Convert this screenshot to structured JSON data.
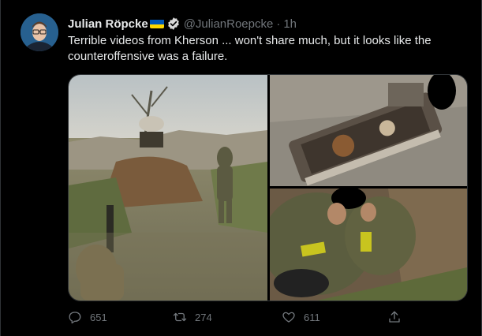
{
  "tweet": {
    "author_name": "Julian Röpcke",
    "handle": "@JulianRoepcke",
    "separator": "·",
    "time": "1h",
    "text": "Terrible videos from Kherson ... won't share much, but it looks like the counteroffensive was a failure.",
    "verified": true
  },
  "actions": {
    "reply_count": "651",
    "retweet_count": "274",
    "like_count": "611"
  },
  "icons": {
    "verified": "verified-badge-icon",
    "flag": "ukraine-flag-icon",
    "reply": "reply-icon",
    "retweet": "retweet-icon",
    "like": "heart-icon",
    "share": "share-icon"
  },
  "colors": {
    "background": "#000000",
    "text_primary": "#e7e9ea",
    "text_secondary": "#71767b",
    "flag_blue": "#0057b7",
    "flag_yellow": "#ffd700"
  }
}
